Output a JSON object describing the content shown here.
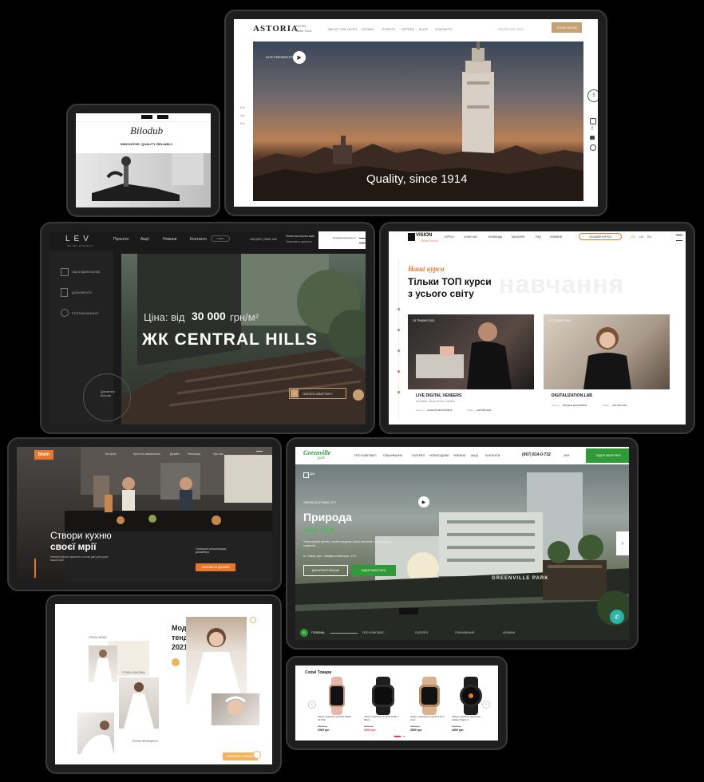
{
  "astoria": {
    "logo": "ASTORIA",
    "logo_sub": "HOTEL",
    "logo_sub2": "since 1914",
    "nav": [
      "ABOUT THE HOTEL",
      "ROOMS",
      "EVENTS",
      "OFFERS",
      "BLOG",
      "CONTACTS"
    ],
    "phone": "+38 032 242 22 01",
    "book_button": "BOOK ROOM",
    "presentation": "OUR PRESENTATION",
    "hero_text": "Quality, since 1914",
    "lang": [
      "EN",
      "UA",
      "RU"
    ],
    "badge": "5"
  },
  "dental": {
    "tagline": "INNOVATIVE. QUALITY. RELIABLY.",
    "logo_script": "Bilodub"
  },
  "lev": {
    "logo": "LEV",
    "logo_sub": "DEVELOPMENT",
    "nav": [
      "Проєкти",
      "Акції",
      "Новини",
      "Контакти"
    ],
    "phone": "+38 (067) 0000 342",
    "consult": "Фінансконсультація",
    "consult_sub": "Замовити дзвінок",
    "badge_text": "Продаж нерухомості",
    "sidebar": [
      "ХІД БУДІВНИЦТВА",
      "ДОКУМЕНТИ",
      "РОЗТАШУВАННЯ"
    ],
    "price_prefix": "Ціна: від",
    "price_value": "30 000",
    "price_unit": "грн/м²",
    "title": "ЖК CENTRAL HILLS",
    "circle_text": "Дізнатись більше",
    "cta": "ОБРАТИ КВАРТИРУ",
    "lang": "UA/EN"
  },
  "vision": {
    "logo": "VISION",
    "logo_script": "Dental school",
    "nav": [
      "КУРСИ",
      "ЧОМУ МИ",
      "КОМАНДА",
      "МАГАЗИН",
      "FAQ",
      "НОВИНИ"
    ],
    "cta": "ОНЛАЙН КУРСИ",
    "lang": [
      "EN",
      "UA",
      "RU"
    ],
    "kicker": "Наші курси",
    "heading1": "Тільки ТОП курси",
    "heading2": "з усього світу",
    "bg_word": "навчання",
    "cards": [
      {
        "date": "15 ТРАВНЯ 2021",
        "title": "LIVE DIGITAL VENEERS",
        "sub": "Vinnytsia, Study Room, Ukraine",
        "lector": "Лектор",
        "lector_name": "НАЗАРІЙ МИХАЙЛЮК",
        "lang_label": "Мова",
        "lang_value": "АНГЛІЙСЬКА"
      },
      {
        "date": "6-7 ГРУДНЯ 2021",
        "title": "DIGITALIZATION.LAB",
        "sub": "",
        "lector": "Лектор",
        "lector_name": "БОГДАН МИХАЙЛЮК",
        "lang_label": "Мова",
        "lang_value": "АНГЛІЙСЬКА"
      }
    ]
  },
  "blum": {
    "logo": "blum",
    "nav": [
      "Тип кухні",
      "Кухні на замовлення",
      "Дизайн",
      "Реалізації",
      "Про нас"
    ],
    "heading1": "Створи кухню",
    "heading2": "своєї мрії",
    "body": "Інтелектуальні рішення та нові ідеї для кухні вашої мрії",
    "cta_text": "Отримати консультацію дизайнера",
    "cta": "ЗАМОВИТИ ДИЗАЙН"
  },
  "greenville": {
    "logo": "Greenville",
    "logo_sub": "park",
    "nav": [
      "ПРО КОМПЛЕКС",
      "ПЛАНУВАННЯ",
      "ГАЛЕРЕЯ",
      "НОВОБУДОВИ",
      "НОВИНИ",
      "АКЦІЇ",
      "КОНТАКТИ"
    ],
    "phone": "(067) 814-0-732",
    "lang": "UKR",
    "cta_top": "ПІДБІР КВАРТИРИ",
    "breadcrumb": "ДІМ",
    "kicker": "GREENVILLE PARK CITY",
    "heading1": "Природа",
    "heading2": "має дім",
    "body": "Унікальний проєкт, який поєднає своїх жителів з природою у гармонії",
    "address": "м. Львів, вул. Замарстинівська, 170",
    "btn1": "ДІЗНАТИСЯ БІЛЬШЕ",
    "btn2": "ПІДБІР КВАРТИРИ",
    "sign": "GREENVILLE PARK",
    "slider_current": "01",
    "slider": [
      "ГОЛОВНА",
      "ПРО КОМПЛЕКС",
      "ГАЛЕРЕЯ",
      "ПЛАНУВАННЯ",
      "НОВИНИ"
    ]
  },
  "wedding": {
    "heading": "Модні тенденції 2021 року",
    "labels": [
      "СТИЛЬ БОХО",
      "СТИЛЬ КЛАСИКА",
      "СТИЛЬ ПРИНЦЕСИ"
    ],
    "cta": "ЗАМОВИТИ ОНЛАЙН"
  },
  "shop": {
    "title": "Схожі Товари",
    "products": [
      {
        "name": "Смарт-годинник Huawei Watch Fit Pink",
        "old": "3999 грн",
        "price": "2999 грн"
      },
      {
        "name": "Смарт-годинник Amazfit GTR 2 Black",
        "old": "4999 грн",
        "price": "3999 грн"
      },
      {
        "name": "Смарт-годинник Amazfit GTS 2 Gold",
        "old": "4599 грн",
        "price": "3599 грн"
      },
      {
        "name": "Смарт-годинник Samsung Galaxy Watch 4",
        "old": "5999 грн",
        "price": "4999 грн"
      }
    ]
  },
  "colors": {
    "gold": "#c7a172",
    "orange": "#e8772e",
    "green": "#2f9a37",
    "teal": "#2bb3a8"
  }
}
